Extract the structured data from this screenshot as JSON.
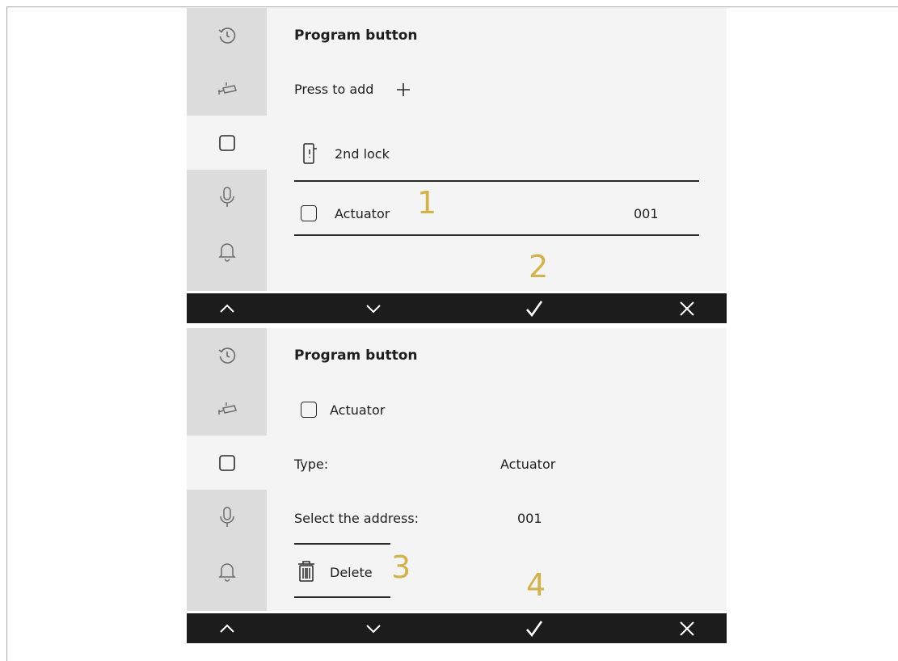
{
  "screens": [
    {
      "title": "Program button",
      "add_label": "Press to add",
      "lock_label": "2nd lock",
      "device_label": "Actuator",
      "device_address": "001",
      "callouts": [
        "1",
        "2"
      ]
    },
    {
      "title": "Program button",
      "device_label": "Actuator",
      "type_label": "Type:",
      "type_value": "Actuator",
      "address_label": "Select the address:",
      "address_value": "001",
      "delete_label": "Delete",
      "callouts": [
        "3",
        "4"
      ]
    }
  ],
  "sidebar_icons": [
    "history-icon",
    "camera-icon",
    "button-icon",
    "microphone-icon",
    "bell-icon"
  ],
  "bottombar_icons": [
    "chevron-up-icon",
    "chevron-down-icon",
    "check-icon",
    "close-icon"
  ],
  "colors": {
    "sidebar": "#dcdcdc",
    "content": "#f4f4f4",
    "bottombar": "#1c1c1c",
    "callout": "#d2b24a"
  }
}
